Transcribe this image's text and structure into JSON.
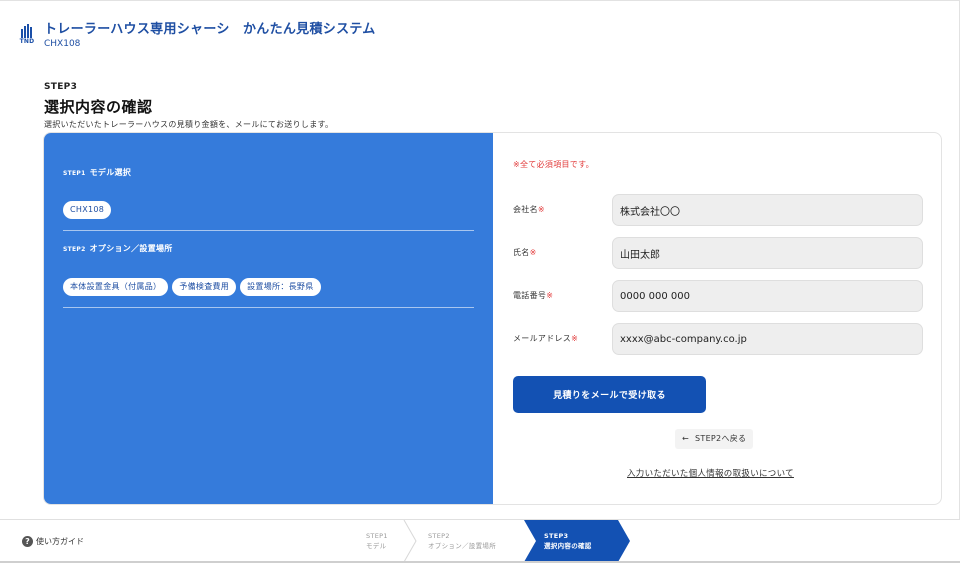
{
  "header": {
    "logo_text": "TND",
    "title": "トレーラーハウス専用シャーシ　かんたん見積システム",
    "subtitle": "CHX108"
  },
  "page": {
    "step_label": "STEP3",
    "title": "選択内容の確認",
    "description": "選択いただいたトレーラーハウスの見積り金額を、メールにてお送りします。"
  },
  "summary": {
    "step1": {
      "prefix": "STEP1",
      "title": "モデル選択",
      "chips": [
        "CHX108"
      ]
    },
    "step2": {
      "prefix": "STEP2",
      "title": "オプション／設置場所",
      "chips": [
        "本体設置金具（付属品）",
        "予備検査費用",
        "設置場所：長野県"
      ]
    }
  },
  "form": {
    "required_note": "※全て必須項目です。",
    "fields": [
      {
        "label": "会社名",
        "required_mark": "※",
        "value": "株式会社〇〇"
      },
      {
        "label": "氏名",
        "required_mark": "※",
        "value": "山田太郎"
      },
      {
        "label": "電話番号",
        "required_mark": "※",
        "value": "0000 000 000"
      },
      {
        "label": "メールアドレス",
        "required_mark": "※",
        "value": "xxxx@abc-company.co.jp"
      }
    ],
    "submit_label": "見積りをメールで受け取る",
    "back_arrow": "←",
    "back_label": "STEP2へ戻る",
    "privacy_link": "入力いただいた個人情報の取扱いについて"
  },
  "footer": {
    "guide_icon": "?",
    "guide_label": "使い方ガイド",
    "steps": [
      {
        "num": "STEP1",
        "label": "モデル",
        "active": false
      },
      {
        "num": "STEP2",
        "label": "オプション／設置場所",
        "active": false
      },
      {
        "num": "STEP3",
        "label": "選択内容の確認",
        "active": true
      }
    ]
  },
  "colors": {
    "brand": "#1f4fa3",
    "panel": "#357bdb",
    "button": "#1351b3",
    "required": "#e23b3b"
  }
}
